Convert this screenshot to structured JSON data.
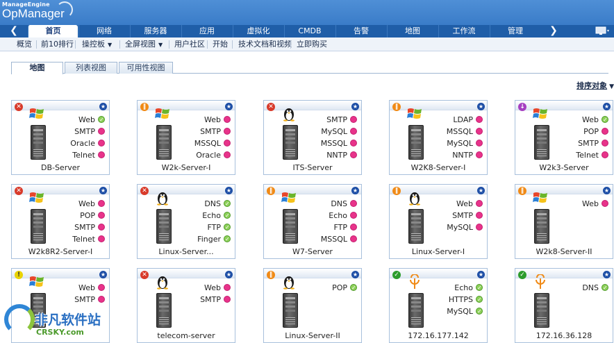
{
  "logo": {
    "brand": "ManageEngine",
    "product": "OpManager"
  },
  "nav": {
    "tabs": [
      "首页",
      "网络",
      "服务器",
      "应用",
      "虚拟化",
      "CMDB",
      "告警",
      "地图",
      "工作流",
      "管理"
    ],
    "active": "首页"
  },
  "submenu": {
    "items": [
      "概览",
      "前10排行",
      "操控板",
      "全屏视图",
      "用户社区",
      "开始",
      "技术文档和视频",
      "立即购买"
    ]
  },
  "view_tabs": [
    "地图",
    "列表视图",
    "可用性视图"
  ],
  "sort_label": "排序对象",
  "devices": [
    {
      "name": "DB-Server",
      "status": "critical",
      "os": "windows-icon",
      "services": [
        {
          "label": "Web",
          "state": "up"
        },
        {
          "label": "SMTP",
          "state": "down"
        },
        {
          "label": "Oracle",
          "state": "down"
        },
        {
          "label": "Telnet",
          "state": "down"
        }
      ]
    },
    {
      "name": "W2k-Server-I",
      "status": "trouble",
      "os": "windows-icon",
      "services": [
        {
          "label": "Web",
          "state": "down"
        },
        {
          "label": "SMTP",
          "state": "down"
        },
        {
          "label": "MSSQL",
          "state": "down"
        },
        {
          "label": "Oracle",
          "state": "down"
        }
      ]
    },
    {
      "name": "ITS-Server",
      "status": "critical",
      "os": "linux-icon",
      "services": [
        {
          "label": "SMTP",
          "state": "down"
        },
        {
          "label": "MySQL",
          "state": "down"
        },
        {
          "label": "MSSQL",
          "state": "down"
        },
        {
          "label": "NNTP",
          "state": "down"
        }
      ]
    },
    {
      "name": "W2K8-Server-I",
      "status": "trouble",
      "os": "windows-icon",
      "services": [
        {
          "label": "LDAP",
          "state": "down"
        },
        {
          "label": "MSSQL",
          "state": "down"
        },
        {
          "label": "MySQL",
          "state": "down"
        },
        {
          "label": "NNTP",
          "state": "down"
        }
      ]
    },
    {
      "name": "W2k3-Server",
      "status": "unmanaged",
      "os": "windows-icon",
      "services": [
        {
          "label": "Web",
          "state": "up"
        },
        {
          "label": "POP",
          "state": "down"
        },
        {
          "label": "SMTP",
          "state": "down"
        },
        {
          "label": "Telnet",
          "state": "down"
        }
      ]
    },
    {
      "name": "W2k8R2-Server-I",
      "status": "critical",
      "os": "windows-icon",
      "services": [
        {
          "label": "Web",
          "state": "down"
        },
        {
          "label": "POP",
          "state": "down"
        },
        {
          "label": "SMTP",
          "state": "down"
        },
        {
          "label": "Telnet",
          "state": "down"
        }
      ]
    },
    {
      "name": "Linux-Server...",
      "status": "critical",
      "os": "linux-icon",
      "services": [
        {
          "label": "DNS",
          "state": "up"
        },
        {
          "label": "Echo",
          "state": "up"
        },
        {
          "label": "FTP",
          "state": "up"
        },
        {
          "label": "Finger",
          "state": "up"
        }
      ]
    },
    {
      "name": "W7-Server",
      "status": "trouble",
      "os": "windows-icon",
      "services": [
        {
          "label": "DNS",
          "state": "down"
        },
        {
          "label": "Echo",
          "state": "down"
        },
        {
          "label": "FTP",
          "state": "down"
        },
        {
          "label": "MSSQL",
          "state": "down"
        }
      ]
    },
    {
      "name": "Linux-Server-I",
      "status": "trouble",
      "os": "linux-icon",
      "services": [
        {
          "label": "Web",
          "state": "down"
        },
        {
          "label": "SMTP",
          "state": "down"
        },
        {
          "label": "MySQL",
          "state": "down"
        }
      ]
    },
    {
      "name": "W2k8-Server-II",
      "status": "trouble",
      "os": "windows-icon",
      "services": [
        {
          "label": "Web",
          "state": "down"
        }
      ]
    },
    {
      "name": "",
      "status": "attention",
      "os": "windows-icon",
      "services": [
        {
          "label": "Web",
          "state": "down"
        },
        {
          "label": "SMTP",
          "state": "down"
        }
      ]
    },
    {
      "name": "telecom-server",
      "status": "critical",
      "os": "linux-icon",
      "services": [
        {
          "label": "Web",
          "state": "down"
        },
        {
          "label": "SMTP",
          "state": "down"
        }
      ]
    },
    {
      "name": "Linux-Server-II",
      "status": "trouble",
      "os": "linux-icon",
      "services": [
        {
          "label": "POP",
          "state": "up"
        }
      ]
    },
    {
      "name": "172.16.177.142",
      "status": "clear",
      "os": "network-icon",
      "services": [
        {
          "label": "Echo",
          "state": "up"
        },
        {
          "label": "HTTPS",
          "state": "up"
        },
        {
          "label": "MySQL",
          "state": "up"
        }
      ]
    },
    {
      "name": "172.16.36.128",
      "status": "clear",
      "os": "network-icon",
      "services": [
        {
          "label": "DNS",
          "state": "up"
        }
      ]
    }
  ],
  "watermark": {
    "cn": "非凡软件站",
    "en": "CRSKY.com"
  },
  "colors": {
    "header": "#3a7cc8",
    "nav": "#1f5ea8",
    "down": "#e8338a",
    "up": "#8ed05a",
    "critical": "#d83a2a",
    "trouble": "#f08a16"
  }
}
